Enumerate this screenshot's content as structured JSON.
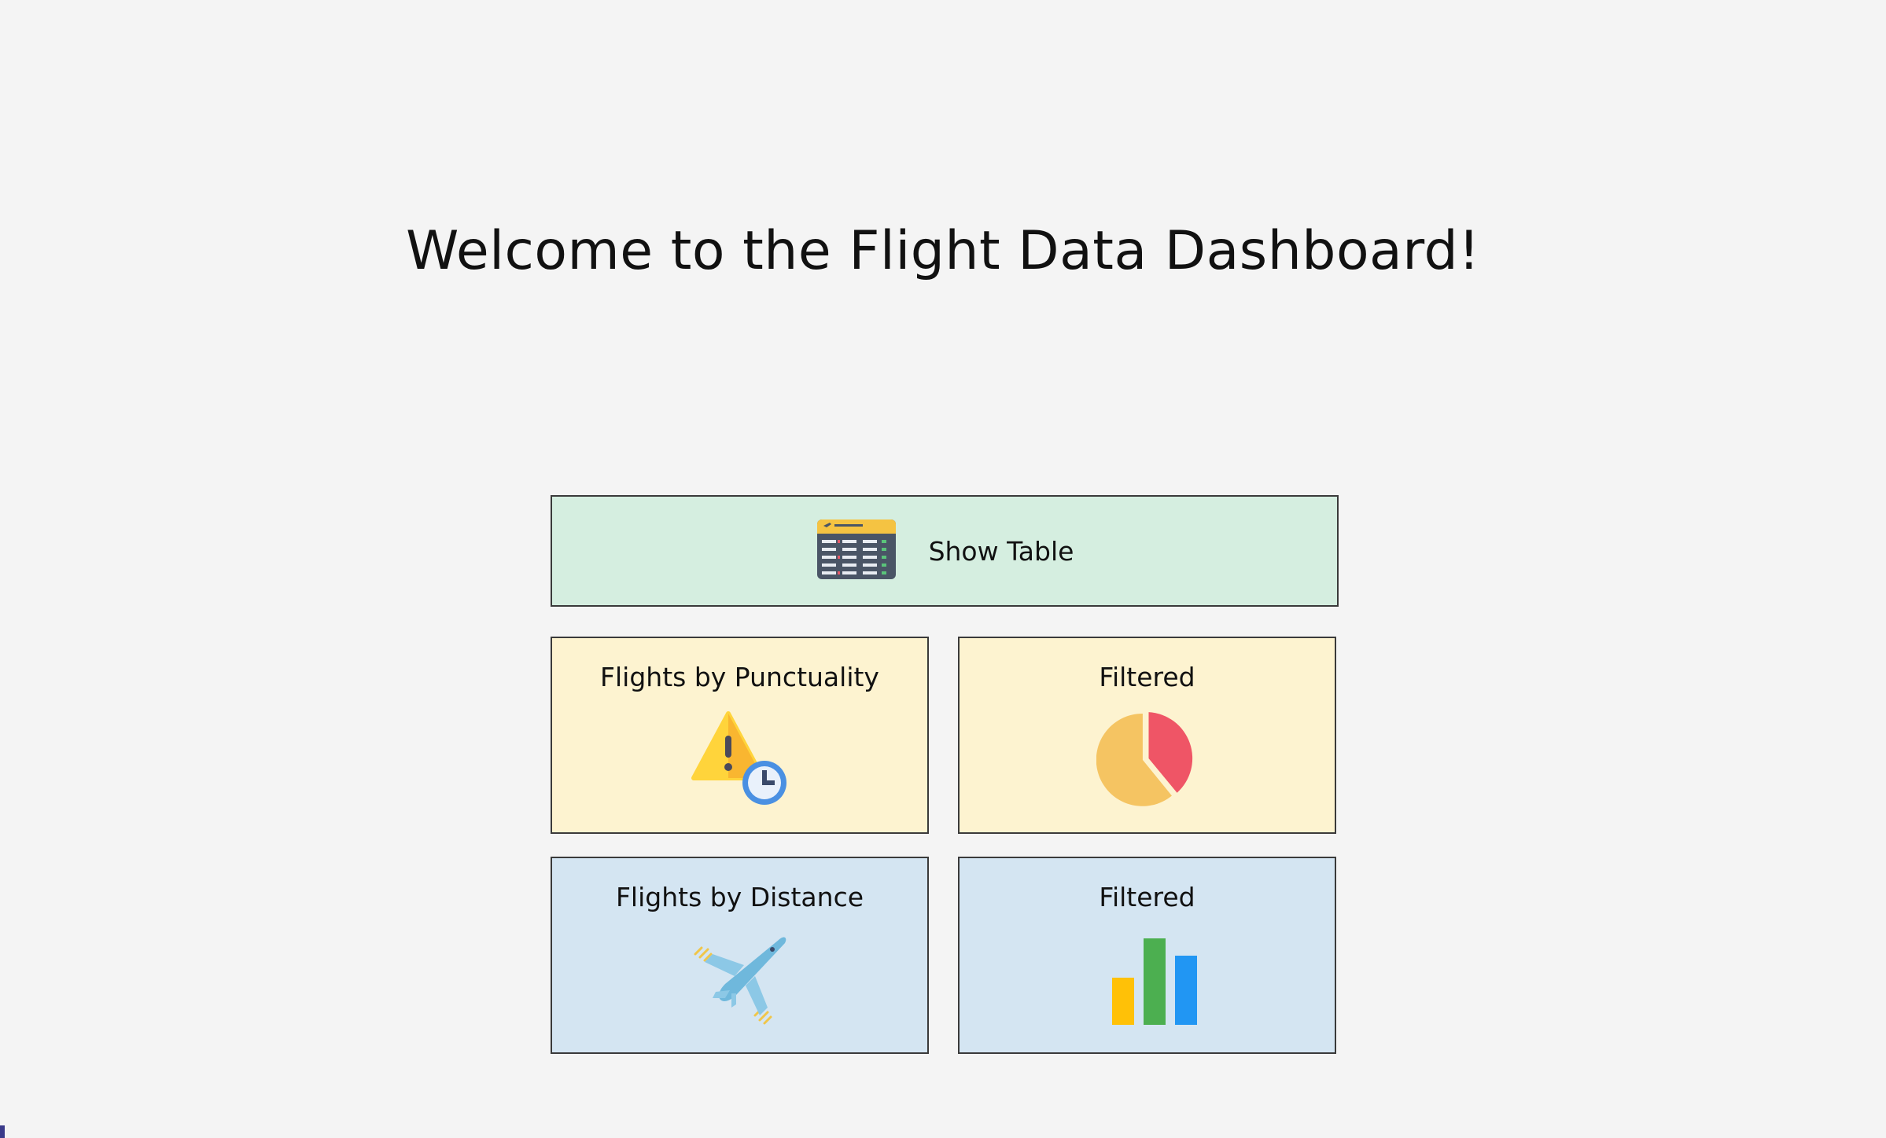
{
  "header": {
    "title": "Welcome to the Flight Data Dashboard!"
  },
  "tiles": {
    "show_table": {
      "label": "Show Table",
      "icon": "flight-board-icon"
    },
    "punctuality": {
      "label": "Flights by Punctuality",
      "icon": "warning-clock-icon"
    },
    "punctuality_filtered": {
      "label": "Filtered",
      "icon": "pie-chart-icon"
    },
    "distance": {
      "label": "Flights by Distance",
      "icon": "airplane-icon"
    },
    "distance_filtered": {
      "label": "Filtered",
      "icon": "bar-chart-icon"
    }
  },
  "colors": {
    "background": "#f4f4f4",
    "table_tile": "#d5eee0",
    "punctuality_tiles": "#fdf3d0",
    "distance_tiles": "#d4e5f2",
    "border": "#3a3a3a"
  }
}
